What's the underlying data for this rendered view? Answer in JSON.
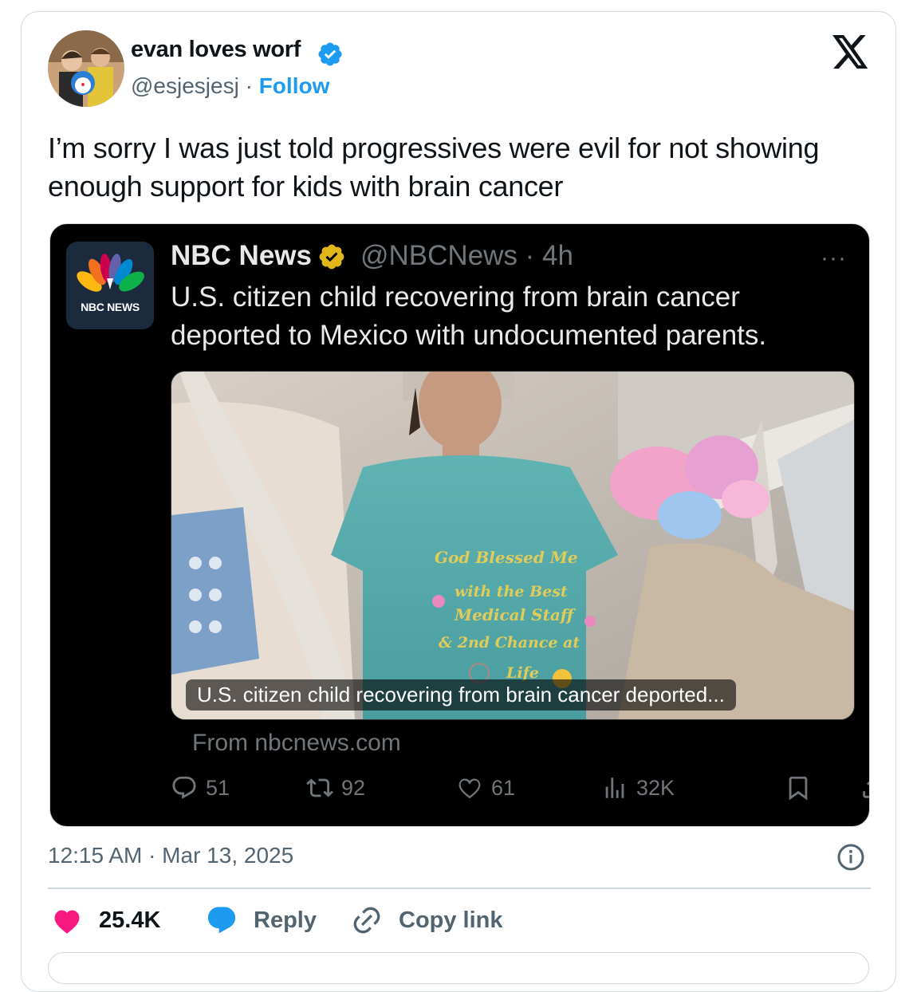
{
  "tweet": {
    "author_name": "evan loves worf",
    "handle": "@esjesjesj",
    "separator": " · ",
    "follow_label": "Follow",
    "text": "I’m sorry I was just told progressives were evil for not showing enough support for kids with brain cancer",
    "timestamp": "12:15 AM · Mar 13, 2025",
    "likes": "25.4K",
    "reply_label": "Reply",
    "copy_link_label": "Copy link"
  },
  "quoted": {
    "author_name": "NBC News",
    "handle_time": "@NBCNews · 4h",
    "avatar_label": "NBC NEWS",
    "more": "···",
    "text": "U.S. citizen child recovering from brain cancer deported to Mexico with undocumented parents.",
    "media_caption": "U.S. citizen child recovering from brain cancer deported...",
    "shirt_text": [
      "God Blessed Me",
      "with the Best",
      "Medical Staff",
      "& 2nd Chance at",
      "Life"
    ],
    "source": "From nbcnews.com",
    "replies": "51",
    "reposts": "92",
    "likes": "61",
    "views": "32K"
  },
  "colors": {
    "accent": "#1d9bf0",
    "like_pink": "#f91880",
    "verified_gold": "#e2b719",
    "embed_bg": "#000000"
  },
  "icons": [
    "verified-badge-icon",
    "x-logo-icon",
    "more-icon",
    "reply-icon",
    "repost-icon",
    "like-icon",
    "views-icon",
    "bookmark-icon",
    "share-icon",
    "info-icon",
    "heart-icon",
    "chat-bubble-icon",
    "link-icon"
  ]
}
